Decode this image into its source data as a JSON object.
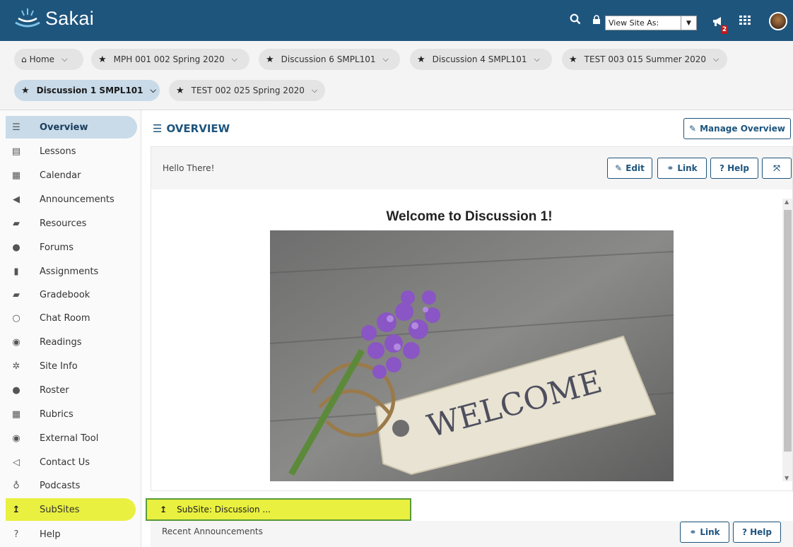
{
  "header": {
    "logo_text": "Sakai",
    "view_site_as": "View Site As:",
    "notification_count": "2",
    "brand_color": "#1e557d"
  },
  "site_tabs": [
    {
      "label": "Home",
      "starred": false,
      "active": false
    },
    {
      "label": "MPH 001 002 Spring 2020",
      "starred": true,
      "active": false
    },
    {
      "label": "Discussion 6 SMPL101",
      "starred": true,
      "active": false
    },
    {
      "label": "Discussion 4 SMPL101",
      "starred": true,
      "active": false
    },
    {
      "label": "TEST 003 015 Summer 2020",
      "starred": true,
      "active": false
    },
    {
      "label": "Discussion 1 SMPL101",
      "starred": true,
      "active": true
    },
    {
      "label": "TEST 002 025 Spring 2020",
      "starred": true,
      "active": false
    }
  ],
  "nav": {
    "items": [
      {
        "label": "Overview",
        "icon": "list-icon"
      },
      {
        "label": "Lessons",
        "icon": "file-icon"
      },
      {
        "label": "Calendar",
        "icon": "calendar-icon"
      },
      {
        "label": "Announcements",
        "icon": "bullhorn-icon"
      },
      {
        "label": "Resources",
        "icon": "folder-icon"
      },
      {
        "label": "Forums",
        "icon": "comments-icon"
      },
      {
        "label": "Assignments",
        "icon": "document-icon"
      },
      {
        "label": "Gradebook",
        "icon": "book-icon"
      },
      {
        "label": "Chat Room",
        "icon": "chat-icon"
      },
      {
        "label": "Readings",
        "icon": "globe-icon"
      },
      {
        "label": "Site Info",
        "icon": "gear-icon"
      },
      {
        "label": "Roster",
        "icon": "users-icon"
      },
      {
        "label": "Rubrics",
        "icon": "table-icon"
      },
      {
        "label": "External Tool",
        "icon": "globe-icon"
      },
      {
        "label": "Contact Us",
        "icon": "send-icon"
      },
      {
        "label": "Podcasts",
        "icon": "microphone-icon"
      },
      {
        "label": "SubSites",
        "icon": "level-up-icon"
      },
      {
        "label": "Help",
        "icon": "question-icon"
      }
    ]
  },
  "main": {
    "title": "OVERVIEW",
    "manage_button": "Manage Overview",
    "widget": {
      "title": "Hello There!",
      "edit": "Edit",
      "link": "Link",
      "help": "? Help",
      "heading": "Welcome to Discussion 1!",
      "sign_text": "WELCOME"
    },
    "subsite_popup": "SubSite: Discussion ...",
    "recent": {
      "title": "Recent Announcements",
      "link": "Link",
      "help": "? Help"
    }
  }
}
